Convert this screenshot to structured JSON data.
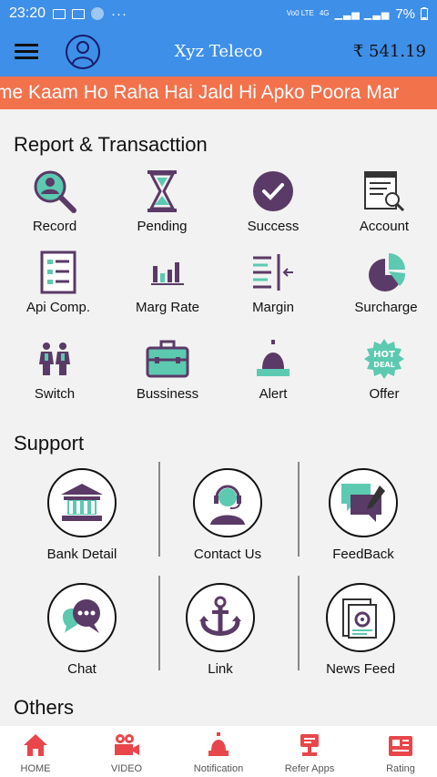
{
  "status_bar": {
    "time": "23:20",
    "network": "Vo0 LTE",
    "signal_label": "4G",
    "battery": "7%"
  },
  "appbar": {
    "title": "Xyz Teleco",
    "balance": "₹ 541.19"
  },
  "marquee": {
    "text": "me Kaam Ho Raha Hai Jald Hi Apko Poora Mar"
  },
  "report": {
    "title": "Report & Transacttion",
    "items": [
      {
        "label": "Record",
        "icon": "search-user-icon"
      },
      {
        "label": "Pending",
        "icon": "hourglass-icon"
      },
      {
        "label": "Success",
        "icon": "check-circle-icon"
      },
      {
        "label": "Account",
        "icon": "document-search-icon"
      },
      {
        "label": "Api Comp.",
        "icon": "list-document-icon"
      },
      {
        "label": "Marg Rate",
        "icon": "bar-chart-icon"
      },
      {
        "label": "Margin",
        "icon": "margin-icon"
      },
      {
        "label": "Surcharge",
        "icon": "pie-chart-icon"
      },
      {
        "label": "Switch",
        "icon": "people-icon"
      },
      {
        "label": "Bussiness",
        "icon": "briefcase-icon"
      },
      {
        "label": "Alert",
        "icon": "bell-icon"
      },
      {
        "label": "Offer",
        "icon": "hot-deal-icon"
      }
    ]
  },
  "support": {
    "title": "Support",
    "items": [
      {
        "label": "Bank Detail",
        "icon": "bank-icon"
      },
      {
        "label": "Contact Us",
        "icon": "headset-agent-icon"
      },
      {
        "label": "FeedBack",
        "icon": "feedback-icon"
      },
      {
        "label": "Chat",
        "icon": "chat-icon"
      },
      {
        "label": "Link",
        "icon": "anchor-icon"
      },
      {
        "label": "News Feed",
        "icon": "news-feed-icon"
      }
    ]
  },
  "others": {
    "title": "Others"
  },
  "bottom_nav": {
    "items": [
      {
        "label": "HOME",
        "icon": "home-icon"
      },
      {
        "label": "VIDEO",
        "icon": "video-camera-icon"
      },
      {
        "label": "Notification",
        "icon": "notification-bell-icon"
      },
      {
        "label": "Refer Apps",
        "icon": "refer-icon"
      },
      {
        "label": "Rating",
        "icon": "rating-icon"
      }
    ]
  },
  "colors": {
    "primary": "#3e8fe8",
    "marquee": "#f2724c",
    "accent_teal": "#5cc9b1",
    "accent_purple": "#5a3a66",
    "nav_red": "#e8464a"
  }
}
